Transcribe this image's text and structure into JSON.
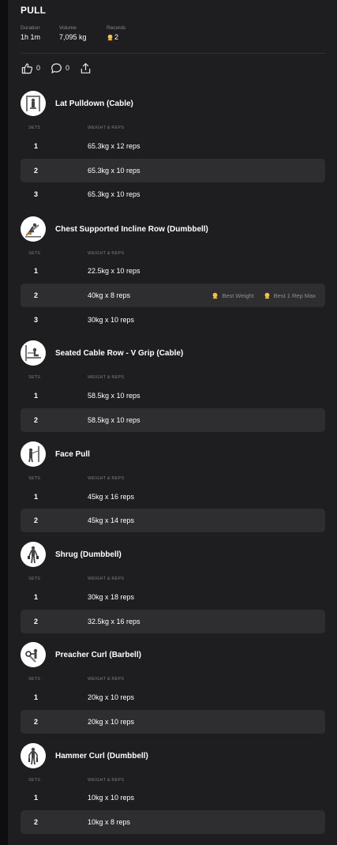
{
  "workout": {
    "title": "PULL",
    "stats": [
      {
        "label": "Duration",
        "value": "1h 1m"
      },
      {
        "label": "Volume",
        "value": "7,095 kg"
      },
      {
        "label": "Records",
        "value": "2",
        "icon": "medal-icon"
      }
    ]
  },
  "social": {
    "likes": "0",
    "comments": "0"
  },
  "columns": {
    "sets": "SETS",
    "weight_reps": "WEIGHT & REPS"
  },
  "colors": {
    "background": "#1e1e20",
    "row_shade": "#2e2e31",
    "medal": "#f5c542"
  },
  "exercises": [
    {
      "name": "Lat Pulldown (Cable)",
      "sets": [
        {
          "num": "1",
          "text": "65.3kg x 12 reps"
        },
        {
          "num": "2",
          "text": "65.3kg x 10 reps"
        },
        {
          "num": "3",
          "text": "65.3kg x 10 reps"
        }
      ]
    },
    {
      "name": "Chest Supported Incline Row (Dumbbell)",
      "sets": [
        {
          "num": "1",
          "text": "22.5kg x 10 reps"
        },
        {
          "num": "2",
          "text": "40kg x 8 reps",
          "badges": [
            "Best Weight",
            "Best 1 Rep Max"
          ]
        },
        {
          "num": "3",
          "text": "30kg x 10 reps"
        }
      ]
    },
    {
      "name": "Seated Cable Row - V Grip (Cable)",
      "sets": [
        {
          "num": "1",
          "text": "58.5kg x 10 reps"
        },
        {
          "num": "2",
          "text": "58.5kg x 10 reps"
        }
      ]
    },
    {
      "name": "Face Pull",
      "sets": [
        {
          "num": "1",
          "text": "45kg x 16 reps"
        },
        {
          "num": "2",
          "text": "45kg x 14 reps"
        }
      ]
    },
    {
      "name": "Shrug (Dumbbell)",
      "sets": [
        {
          "num": "1",
          "text": "30kg x 18 reps"
        },
        {
          "num": "2",
          "text": "32.5kg x 16 reps"
        }
      ]
    },
    {
      "name": "Preacher Curl (Barbell)",
      "sets": [
        {
          "num": "1",
          "text": "20kg x 10 reps"
        },
        {
          "num": "2",
          "text": "20kg x 10 reps"
        }
      ]
    },
    {
      "name": "Hammer Curl (Dumbbell)",
      "sets": [
        {
          "num": "1",
          "text": "10kg x 10 reps"
        },
        {
          "num": "2",
          "text": "10kg x 8 reps"
        }
      ]
    }
  ]
}
